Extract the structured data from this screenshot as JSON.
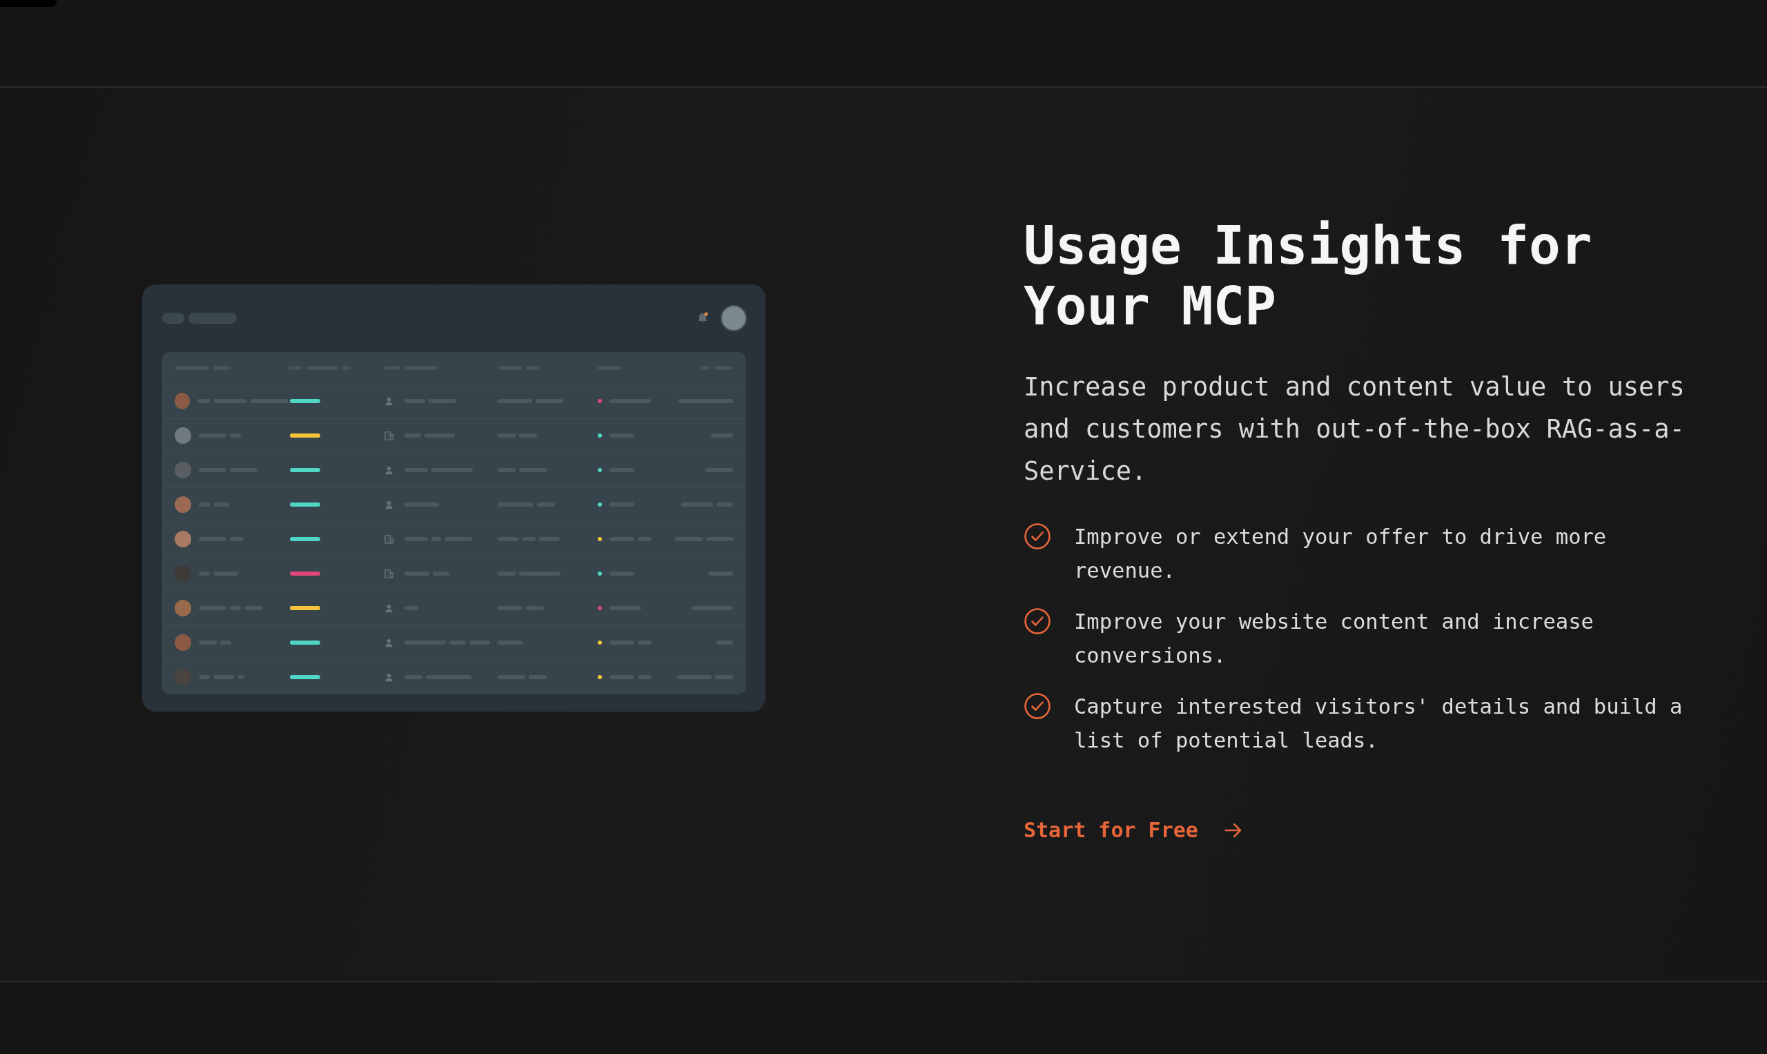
{
  "heading": "Usage Insights for Your MCP",
  "intro": "Increase product and content value to users and customers with out-of-the-box RAG-as-a-Service.",
  "benefits": [
    "Improve or extend your offer to drive more revenue.",
    "Improve your website content and increase conversions.",
    "Capture interested visitors' details and build a list of potential leads."
  ],
  "cta": {
    "label": "Start for Free"
  },
  "dashboard": {
    "rows": [
      {
        "kind": "person",
        "bar": {
          "color": "#4fd6c4"
        },
        "status": {
          "color": "#e0467a"
        }
      },
      {
        "kind": "building",
        "bar": {
          "color": "#f4c33a"
        },
        "status": {
          "color": "#4fd6c4"
        }
      },
      {
        "kind": "person",
        "bar": {
          "color": "#4fd6c4"
        },
        "status": {
          "color": "#4fd6c4"
        }
      },
      {
        "kind": "person",
        "bar": {
          "color": "#4fd6c4"
        },
        "status": {
          "color": "#4fd6c4"
        }
      },
      {
        "kind": "building",
        "bar": {
          "color": "#4fd6c4"
        },
        "status": {
          "color": "#f4c33a"
        }
      },
      {
        "kind": "building",
        "bar": {
          "color": "#e0467a"
        },
        "status": {
          "color": "#4fd6c4"
        }
      },
      {
        "kind": "person",
        "bar": {
          "color": "#f4c33a"
        },
        "status": {
          "color": "#e0467a"
        }
      },
      {
        "kind": "person",
        "bar": {
          "color": "#4fd6c4"
        },
        "status": {
          "color": "#f4c33a"
        }
      },
      {
        "kind": "person",
        "bar": {
          "color": "#4fd6c4"
        },
        "status": {
          "color": "#f4c33a"
        }
      }
    ]
  }
}
